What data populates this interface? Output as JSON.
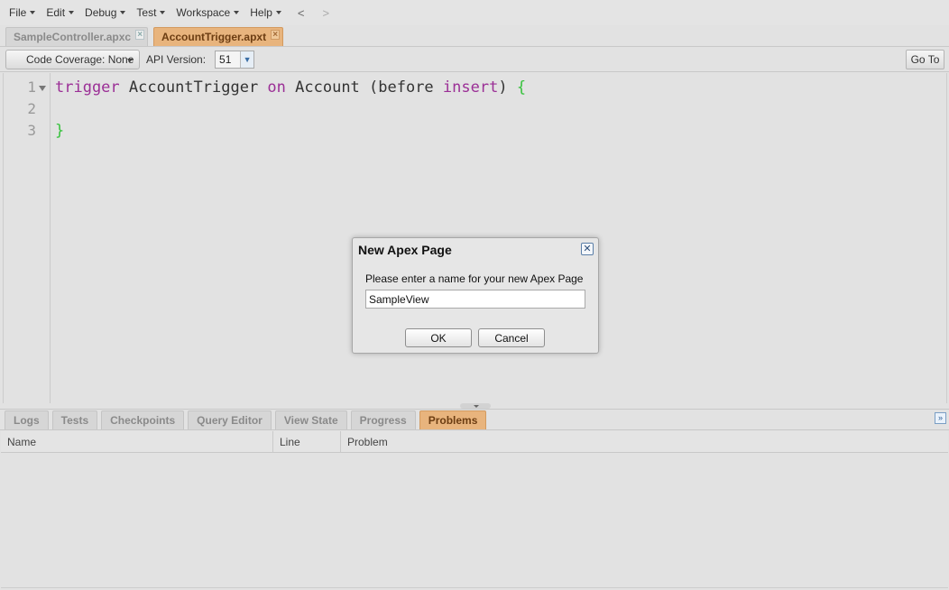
{
  "menu": {
    "items": [
      "File",
      "Edit",
      "Debug",
      "Test",
      "Workspace",
      "Help"
    ],
    "back": "<",
    "forward": ">"
  },
  "file_tabs": [
    {
      "label": "SampleController.apxc",
      "active": false
    },
    {
      "label": "AccountTrigger.apxt",
      "active": true
    }
  ],
  "toolbar": {
    "code_coverage": "Code Coverage: None",
    "api_label": "API Version:",
    "api_value": "51",
    "goto": "Go To"
  },
  "editor": {
    "line_numbers": [
      "1",
      "2",
      "3"
    ],
    "code": {
      "kw_trigger": "trigger",
      "name": " AccountTrigger ",
      "kw_on": "on",
      "object": " Account (before ",
      "kw_insert": "insert",
      "paren_close": ") ",
      "brace_open": "{",
      "brace_close": "}"
    }
  },
  "bottom_tabs": [
    {
      "label": "Logs",
      "active": false
    },
    {
      "label": "Tests",
      "active": false
    },
    {
      "label": "Checkpoints",
      "active": false
    },
    {
      "label": "Query Editor",
      "active": false
    },
    {
      "label": "View State",
      "active": false
    },
    {
      "label": "Progress",
      "active": false
    },
    {
      "label": "Problems",
      "active": true
    }
  ],
  "problems": {
    "columns": [
      "Name",
      "Line",
      "Problem"
    ]
  },
  "dialog": {
    "title": "New Apex Page",
    "prompt": "Please enter a name for your new Apex Page",
    "input_value": "SampleView",
    "ok": "OK",
    "cancel": "Cancel"
  },
  "colors": {
    "active_tab": "#e8b47d",
    "keyword": "#9b2f96",
    "brace": "#36c23c"
  }
}
